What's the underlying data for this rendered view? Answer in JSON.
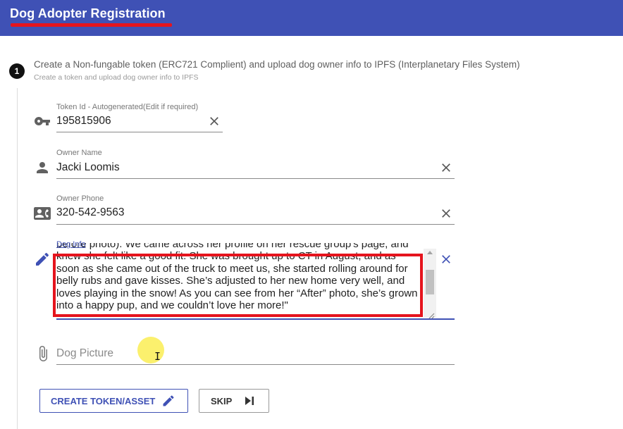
{
  "app": {
    "title": "Dog Adopter Registration",
    "accent_color": "#3f51b5",
    "highlight_color": "#e5141d"
  },
  "step": {
    "number": "1",
    "title": "Create a Non-fungable token (ERC721 Complient) and upload dog owner info to IPFS (Interplanetary Files System)",
    "subtitle": "Create a token and upload dog owner info to IPFS"
  },
  "fields": {
    "token_id": {
      "label": "Token Id - Autogenerated(Edit if required)",
      "value": "195815906",
      "icon": "key-icon"
    },
    "owner_name": {
      "label": "Owner Name",
      "value": "Jacki Loomis",
      "icon": "person-icon"
    },
    "owner_phone": {
      "label": "Owner Phone",
      "value": "320-542-9563",
      "icon": "contact-phone-icon"
    },
    "dog_info": {
      "label": "Dog Info",
      "icon": "pencil-icon",
      "value": "before photo). We came across her profile on her rescue group's page, and\nknew she felt like a good fit. She was brought up to CT in August, and as\nsoon as she came out of the truck to meet us, she started rolling around for\nbelly rubs and gave kisses. She’s adjusted to her new home very well, and\nloves playing in the snow! As you can see from her “After” photo, she’s grown\ninto a happy pup, and we couldn’t love her more!\""
    },
    "dog_picture": {
      "placeholder": "Dog Picture",
      "icon": "paperclip-icon"
    }
  },
  "buttons": {
    "create": "CREATE TOKEN/ASSET",
    "skip": "SKIP"
  }
}
